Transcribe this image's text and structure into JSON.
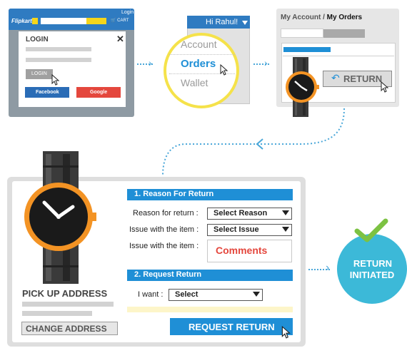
{
  "panel1": {
    "brand": "Flipkart",
    "login_link": "Login",
    "cart": "🛒 CART",
    "dialog_title": "LOGIN",
    "close_icon": "close-icon",
    "login_button": "LOGIN",
    "facebook_button": "Facebook",
    "google_button": "Google"
  },
  "panel2": {
    "greeting": "Hi Rahul!",
    "items": [
      "Account",
      "Orders",
      "Wallet"
    ]
  },
  "panel3": {
    "breadcrumb_a": "My Account",
    "breadcrumb_sep": " / ",
    "breadcrumb_b": "My Orders",
    "return_button": "RETURN"
  },
  "form": {
    "section1": "1. Reason For Return",
    "reason_label": "Reason for return :",
    "reason_select": "Select Reason",
    "issue_label": "Issue with the item :",
    "issue_select": "Select Issue",
    "comments_label": "Issue with the item :",
    "comments_placeholder": "Comments",
    "section2": "2. Request Return",
    "want_label": "I want :",
    "want_select": "Select",
    "request_button": "REQUEST RETURN"
  },
  "address": {
    "title": "PICK UP ADDRESS",
    "change_button": "CHANGE  ADDRESS"
  },
  "result": {
    "line1": "RETURN",
    "line2": "INITIATED"
  },
  "colors": {
    "brand_blue": "#2f7bc1",
    "accent_blue": "#1f8fd6",
    "facebook": "#2a6cb6",
    "google": "#e4473d",
    "success_teal": "#3cb9d8",
    "check_green": "#7cc242",
    "watch_orange": "#f39324",
    "highlight_yellow": "#f5e24a"
  }
}
